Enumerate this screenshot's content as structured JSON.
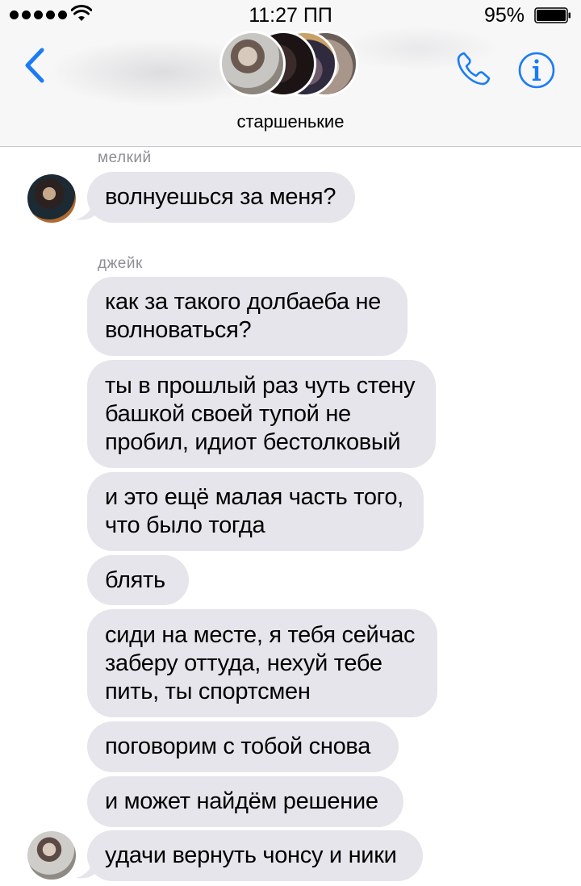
{
  "status_bar": {
    "time": "11:27 ПП",
    "battery_percent": "95%",
    "signal_bars": 5,
    "battery_level": 0.95
  },
  "header": {
    "group_name": "старшенькие",
    "back_icon": "chevron-left-icon",
    "call_icon": "phone-icon",
    "info_icon": "info-icon",
    "accent_color": "#1a7cf5"
  },
  "messages": [
    {
      "sender": "мелкий",
      "text": "волнуешься за меня?"
    },
    {
      "sender": "джейк",
      "text": "как за такого долбаеба не\nволноваться?"
    },
    {
      "sender": "",
      "text": "ты в прошлый раз чуть стену\nбашкой своей тупой не\nпробил, идиот бестолковый"
    },
    {
      "sender": "",
      "text": "и это ещё малая часть того,\nчто было тогда"
    },
    {
      "sender": "",
      "text": "блять"
    },
    {
      "sender": "",
      "text": "сиди на месте, я тебя сейчас\nзаберу оттуда, нехуй тебе\nпить, ты спортсмен"
    },
    {
      "sender": "",
      "text": "поговорим с тобой снова"
    },
    {
      "sender": "",
      "text": "и может найдём решение"
    },
    {
      "sender": "",
      "text": "удачи вернуть чонсу и ники"
    }
  ],
  "colors": {
    "bubble_incoming": "#e6e5eb",
    "header_bg": "#f7f7f7",
    "sender_label": "#8e8e93"
  }
}
